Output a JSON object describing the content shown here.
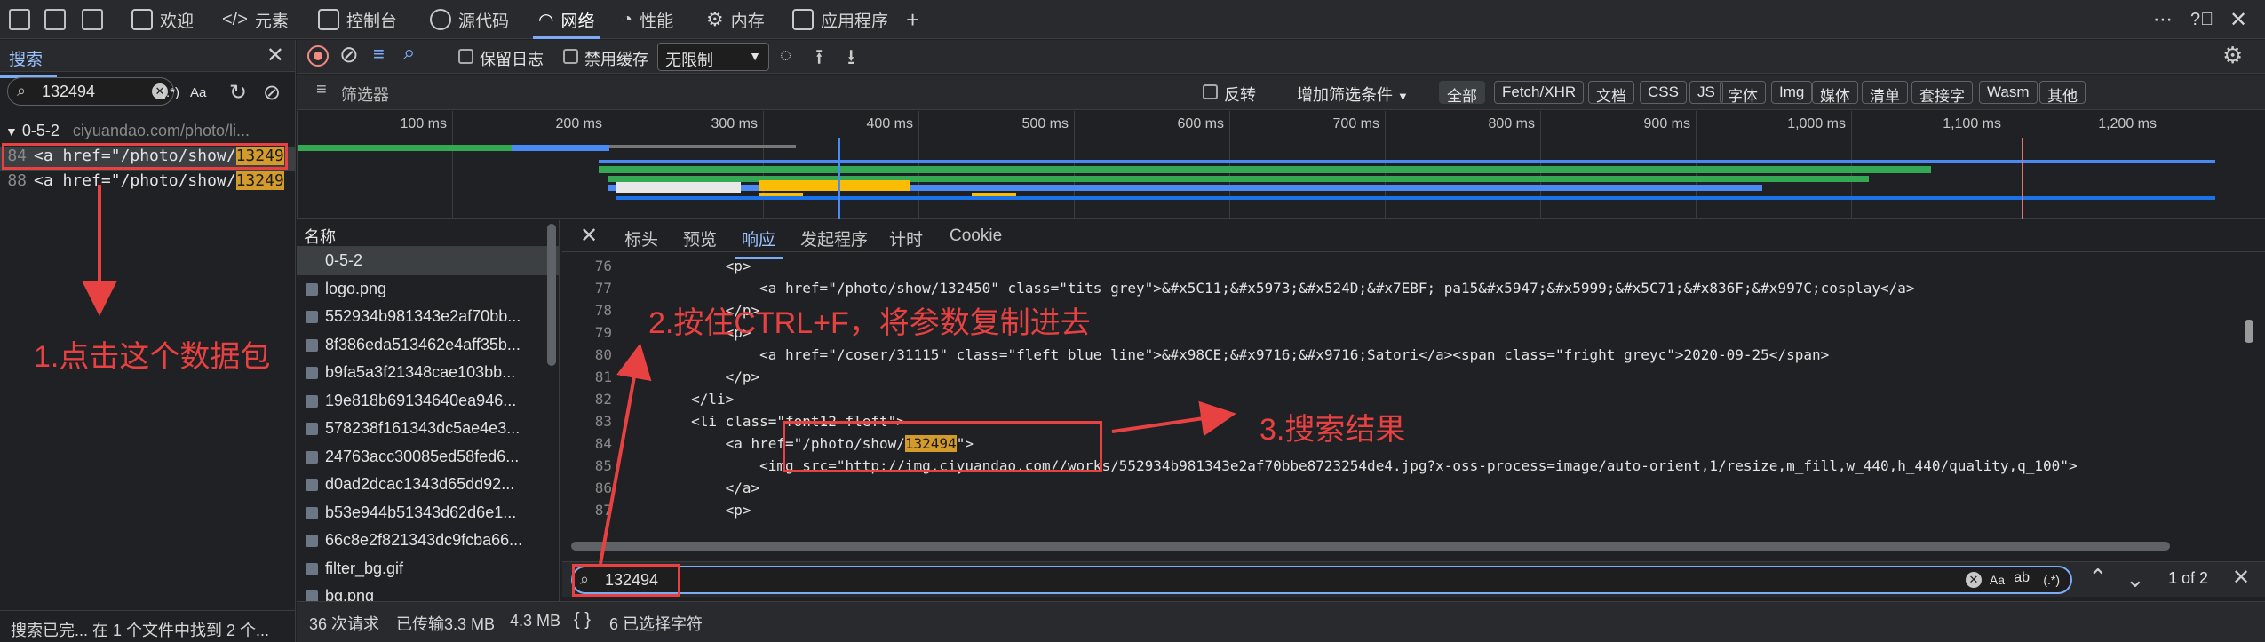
{
  "top_tabs": [
    {
      "label": "欢迎",
      "icon": "home-icon"
    },
    {
      "label": "元素",
      "icon": "code-icon"
    },
    {
      "label": "控制台",
      "icon": "console-icon"
    },
    {
      "label": "源代码",
      "icon": "bug-icon"
    },
    {
      "label": "网络",
      "icon": "wifi-icon"
    },
    {
      "label": "性能",
      "icon": "performance-icon"
    },
    {
      "label": "内存",
      "icon": "memory-icon"
    },
    {
      "label": "应用程序",
      "icon": "application-icon"
    }
  ],
  "search_panel": {
    "title": "搜索",
    "query": "132494",
    "regex_label": "(.*)",
    "case_label": "Aa",
    "file_line": "0-5-2",
    "file_url": "ciyuandao.com/photo/li...",
    "results": [
      {
        "line": "84",
        "prefix": "<a href=\"/photo/show/",
        "match": "13249"
      },
      {
        "line": "88",
        "prefix": "<a href=\"/photo/show/",
        "match": "13249"
      }
    ],
    "status": "搜索已完...  在 1 个文件中找到 2 个..."
  },
  "net_toolbar": {
    "preserve_log": "保留日志",
    "disable_cache": "禁用缓存",
    "throttle": "无限制"
  },
  "filter_bar": {
    "placeholder": "筛选器",
    "invert": "反转",
    "more_filters": "增加筛选条件",
    "chips": [
      "全部",
      "Fetch/XHR",
      "文档",
      "CSS",
      "JS",
      "字体",
      "Img",
      "媒体",
      "清单",
      "套接字",
      "Wasm",
      "其他"
    ]
  },
  "timeline_ticks": [
    "100 ms",
    "200 ms",
    "300 ms",
    "400 ms",
    "500 ms",
    "600 ms",
    "700 ms",
    "800 ms",
    "900 ms",
    "1,000 ms",
    "1,100 ms",
    "1,200 ms"
  ],
  "names": {
    "header": "名称",
    "rows": [
      "0-5-2",
      "logo.png",
      "552934b981343e2af70bb...",
      "8f386eda513462e4aff35b...",
      "b9fa5a3f21348cae103bb...",
      "19e818b69134640ea946...",
      "578238f161343dc5ae4e3...",
      "24763acc30085ed58fed6...",
      "d0ad2dcac1343d65dd92...",
      "b53e944b51343d62d6e1...",
      "66c8e2f821343dc9fcba66...",
      "filter_bg.gif",
      "bg.png"
    ]
  },
  "detail_tabs": [
    "标头",
    "预览",
    "响应",
    "发起程序",
    "计时",
    "Cookie"
  ],
  "code_lines": [
    {
      "n": "76",
      "text": "            <p>"
    },
    {
      "n": "77",
      "text": "                <a href=\"/photo/show/132450\" class=\"tits grey\">&#x5C11;&#x5973;&#x524D;&#x7EBF; pa15&#x5947;&#x5999;&#x5C71;&#x836F;&#x997C;cosplay</a>"
    },
    {
      "n": "78",
      "text": "            </p>"
    },
    {
      "n": "79",
      "text": "            <p>"
    },
    {
      "n": "80",
      "text": "                <a href=\"/coser/31115\" class=\"fleft blue line\">&#x98CE;&#x9716;&#x9716;Satori</a><span class=\"fright greyc\">2020-09-25</span>"
    },
    {
      "n": "81",
      "text": "            </p>"
    },
    {
      "n": "82",
      "text": "        </li>"
    },
    {
      "n": "83",
      "text": "        <li class=\"font12 fleft\">"
    },
    {
      "n": "84",
      "text": "            <a href=\"/photo/show/132494\">"
    },
    {
      "n": "85",
      "text": "                <img src=\"http://img.ciyuandao.com//works/552934b981343e2af70bbe8723254de4.jpg?x-oss-process=image/auto-orient,1/resize,m_fill,w_440,h_440/quality,q_100\">"
    },
    {
      "n": "86",
      "text": "            </a>"
    },
    {
      "n": "87",
      "text": "            <p>"
    }
  ],
  "find": {
    "query": "132494",
    "count": "1 of 2",
    "case_label": "Aa",
    "regex_label": "(.*)"
  },
  "bottom": {
    "requests": "36 次请求",
    "transferred": "已传输3.3 MB",
    "resources": "4.3 MB",
    "braces": "{ }",
    "selected": "6 已选择字符"
  },
  "annotations": {
    "step1": "1.点击这个数据包",
    "step2": "2.按住CTRL+F，将参数复制进去",
    "step3": "3.搜索结果"
  },
  "colors": {
    "accent": "#7cacf8",
    "annotation": "#e84141",
    "match": "#d39b2b"
  }
}
